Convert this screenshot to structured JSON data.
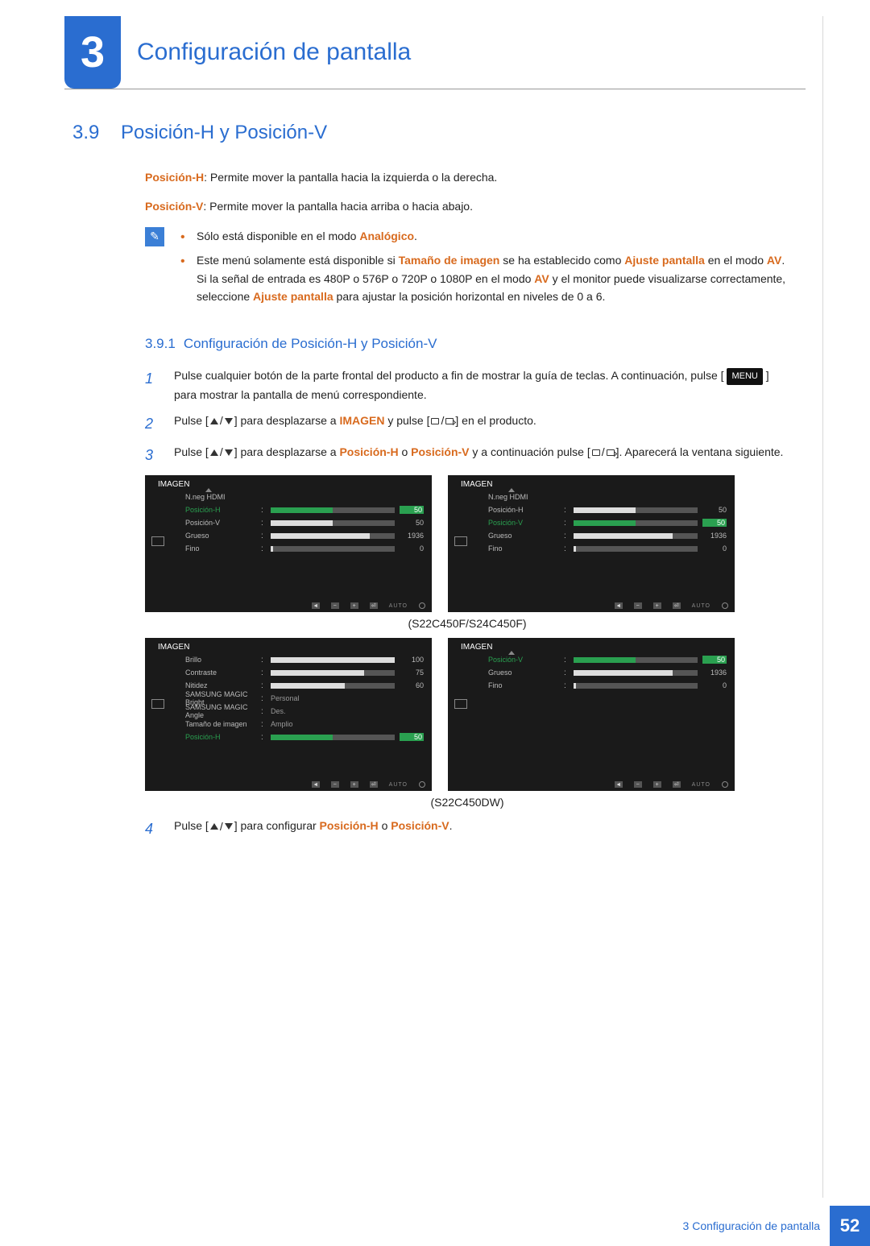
{
  "header": {
    "chapter_number": "3",
    "chapter_title": "Configuración de pantalla"
  },
  "section": {
    "number": "3.9",
    "title": "Posición-H y Posición-V",
    "desc_h_label": "Posición-H",
    "desc_h_text": ": Permite mover la pantalla hacia la izquierda o la derecha.",
    "desc_v_label": "Posición-V",
    "desc_v_text": ": Permite mover la pantalla hacia arriba o hacia abajo."
  },
  "notes": [
    {
      "a": "Sólo está disponible en el modo ",
      "b": "Analógico",
      "c": "."
    },
    {
      "a": "Este menú solamente está disponible si ",
      "b": "Tamaño de imagen",
      "c": " se ha establecido como ",
      "d": "Ajuste pantalla",
      "e": " en el modo ",
      "f": "AV",
      "g": ". Si la señal de entrada es 480P o 576P o 720P o 1080P en el modo ",
      "h": "AV",
      "i": " y el monitor puede visualizarse correctamente, seleccione ",
      "j": "Ajuste pantalla",
      "k": " para ajustar la posición horizontal en niveles de 0 a 6."
    }
  ],
  "subsection": {
    "number": "3.9.1",
    "title": "Configuración de Posición-H y Posición-V"
  },
  "steps": [
    {
      "n": "1",
      "a": "Pulse cualquier botón de la parte frontal del producto a fin de mostrar la guía de teclas. A continuación, pulse [",
      "b": "] para mostrar la pantalla de menú correspondiente."
    },
    {
      "n": "2",
      "a": "Pulse",
      "b": "para desplazarse a",
      "c": "IMAGEN",
      "d": "y pulse",
      "e": "en el producto."
    },
    {
      "n": "3",
      "a": "Pulse",
      "b": "para desplazarse a",
      "c": "Posición-H",
      "d": "o",
      "e": "Posición-V",
      "f": "y a continuación pulse",
      "g": "Aparecerá la ventana siguiente."
    },
    {
      "n": "4",
      "a": "Pulse",
      "b": "para configurar",
      "c": "Posición-H",
      "d": "o",
      "e": "Posición-V",
      "f": "."
    }
  ],
  "icons": {
    "menu": "MENU",
    "auto": "AUTO"
  },
  "osd1": {
    "title": "IMAGEN",
    "items": [
      {
        "label": "N.neg HDMI"
      },
      {
        "label": "Posición-H",
        "val": "50"
      },
      {
        "label": "Posición-V",
        "val": "50"
      },
      {
        "label": "Grueso",
        "val": "1936"
      },
      {
        "label": "Fino",
        "val": "0"
      }
    ]
  },
  "osd2": {
    "title": "IMAGEN",
    "items": [
      {
        "label": "N.neg HDMI"
      },
      {
        "label": "Posición-H",
        "val": "50"
      },
      {
        "label": "Posición-V",
        "val": "50"
      },
      {
        "label": "Grueso",
        "val": "1936"
      },
      {
        "label": "Fino",
        "val": "0"
      }
    ]
  },
  "osd3": {
    "title": "IMAGEN",
    "items": [
      {
        "label": "Brillo",
        "val": "100"
      },
      {
        "label": "Contraste",
        "val": "75"
      },
      {
        "label": "Nitidez",
        "val": "60"
      },
      {
        "label": "SAMSUNG MAGIC Bright",
        "val": "Personal"
      },
      {
        "label": "SAMSUNG MAGIC Angle",
        "val": "Des."
      },
      {
        "label": "Tamaño de imagen",
        "val": "Amplio"
      },
      {
        "label": "Posición-H",
        "val": "50"
      }
    ]
  },
  "osd4": {
    "title": "IMAGEN",
    "items": [
      {
        "label": "Posición-V",
        "val": "50"
      },
      {
        "label": "Grueso",
        "val": "1936"
      },
      {
        "label": "Fino",
        "val": "0"
      }
    ]
  },
  "captions": [
    "(S22C450F/S24C450F)",
    "(S22C450DW)"
  ],
  "footer": {
    "num": "3",
    "title": "Configuración de pantalla",
    "page": "52"
  }
}
